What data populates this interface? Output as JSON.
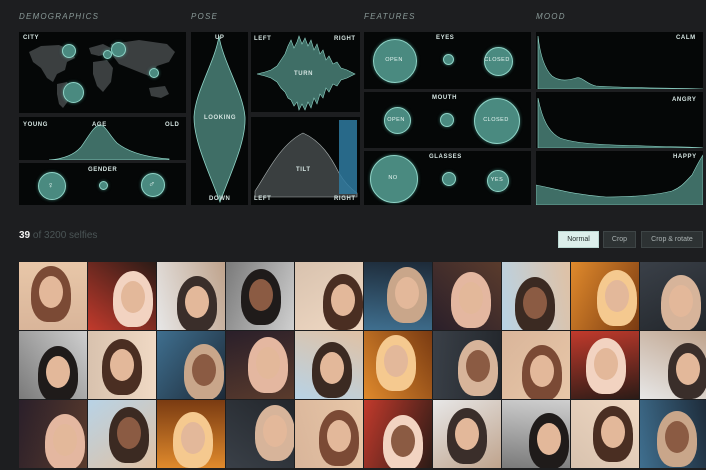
{
  "sections": {
    "demographics": "DEMOGRAPHICS",
    "pose": "POSE",
    "features": "FEATURES",
    "mood": "MOOD"
  },
  "demographics": {
    "city": "CITY",
    "age": {
      "young": "YOUNG",
      "title": "AGE",
      "old": "OLD"
    },
    "gender": {
      "title": "GENDER"
    }
  },
  "pose": {
    "up": "UP",
    "looking": "LOOKING",
    "down": "DOWN",
    "turn": {
      "left": "LEFT",
      "title": "TURN",
      "right": "RIGHT"
    },
    "tilt": {
      "left": "LEFT",
      "title": "TILT",
      "right": "RIGHT"
    }
  },
  "features": {
    "eyes": {
      "title": "EYES",
      "open": "OPEN",
      "closed": "CLOSED"
    },
    "mouth": {
      "title": "MOUTH",
      "open": "OPEN",
      "closed": "CLOSED"
    },
    "glasses": {
      "title": "GLASSES",
      "no": "NO",
      "yes": "YES"
    }
  },
  "mood": {
    "calm": "CALM",
    "angry": "ANGRY",
    "happy": "HAPPY"
  },
  "selection": {
    "count": "39",
    "total_text": "of 3200 selfies"
  },
  "view_modes": {
    "normal": "Normal",
    "crop": "Crop",
    "crop_rotate": "Crop & rotate",
    "selected": "normal"
  },
  "colors": {
    "background": "#1d1e20",
    "panel": "#050707",
    "accent": "#5fb5a6",
    "accent_light": "#8fd3c6",
    "selected_button": "#dcefeb"
  }
}
